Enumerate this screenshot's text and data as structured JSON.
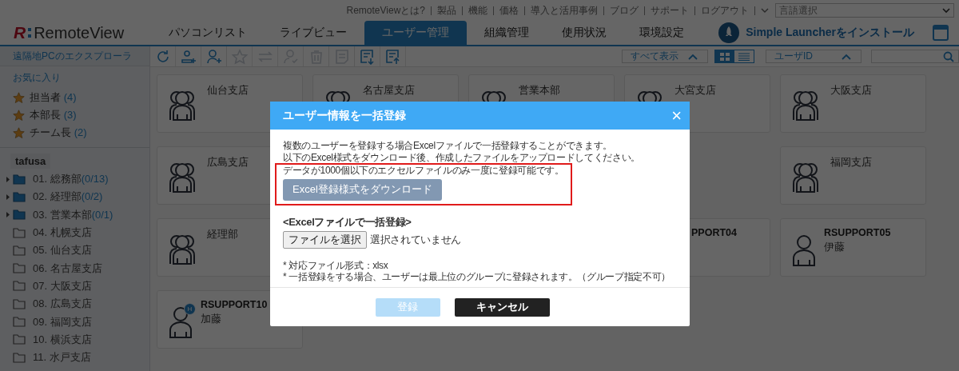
{
  "top_links": [
    "RemoteViewとは?",
    "製品",
    "機能",
    "価格",
    "導入と活用事例",
    "ブログ",
    "サポート",
    "ログアウト"
  ],
  "language_select": {
    "value": "言語選択"
  },
  "logo": {
    "mark": "R",
    "text": "RemoteView"
  },
  "nav_tabs": [
    {
      "label": "パソコンリスト",
      "selected": false
    },
    {
      "label": "ライブビュー",
      "selected": false
    },
    {
      "label": "ユーザー管理",
      "selected": true
    },
    {
      "label": "組織管理",
      "selected": false
    },
    {
      "label": "使用状況",
      "selected": false
    },
    {
      "label": "環境設定",
      "selected": false
    }
  ],
  "launcher": {
    "label": "Simple Launcherをインストール"
  },
  "sidebar": {
    "explorer_link": "遠隔地PCのエクスプローラ",
    "favorites_title": "お気に入り",
    "favorites": [
      {
        "name": "担当者",
        "count": "(4)"
      },
      {
        "name": "本部長",
        "count": "(3)"
      },
      {
        "name": "チーム長",
        "count": "(2)"
      }
    ],
    "tree_root": "tafusa",
    "groups": [
      {
        "label": "01. 総務部",
        "count": "(0/13)",
        "has_children": true
      },
      {
        "label": "02. 経理部",
        "count": "(0/2)",
        "has_children": true
      },
      {
        "label": "03. 営業本部",
        "count": "(0/1)",
        "has_children": true
      },
      {
        "label": "04. 札幌支店",
        "has_children": false
      },
      {
        "label": "05. 仙台支店",
        "has_children": false
      },
      {
        "label": "06. 名古屋支店",
        "has_children": false
      },
      {
        "label": "07. 大阪支店",
        "has_children": false
      },
      {
        "label": "08. 広島支店",
        "has_children": false
      },
      {
        "label": "09. 福岡支店",
        "has_children": false
      },
      {
        "label": "10. 横浜支店",
        "has_children": false
      },
      {
        "label": "11. 水戸支店",
        "has_children": false
      }
    ]
  },
  "toolbar": {
    "tools": [
      {
        "kind": "refresh",
        "disabled": false
      },
      {
        "kind": "add-group",
        "disabled": false
      },
      {
        "kind": "add-user",
        "disabled": false
      },
      {
        "kind": "star",
        "disabled": true
      },
      {
        "kind": "transfer",
        "disabled": true
      },
      {
        "kind": "user-check",
        "disabled": true
      },
      {
        "kind": "trash",
        "disabled": true
      },
      {
        "kind": "note",
        "disabled": true
      },
      {
        "kind": "download",
        "disabled": false
      },
      {
        "kind": "upload",
        "disabled": false
      }
    ],
    "filter": "すべて表示",
    "view_modes": [
      {
        "kind": "grid",
        "selected": true
      },
      {
        "kind": "list",
        "selected": false
      }
    ],
    "sort": "ユーザID"
  },
  "cards": [
    [
      {
        "kind": "group",
        "name": "仙台支店"
      },
      {
        "kind": "group-top",
        "name": "名古屋支店"
      },
      {
        "kind": "group-top",
        "name": "営業本部"
      },
      {
        "kind": "group-top",
        "name": "大宮支店"
      },
      {
        "kind": "group",
        "name": "大阪支店"
      }
    ],
    [
      {
        "kind": "group",
        "name": "広島支店"
      },
      {
        "kind": "covered"
      },
      {
        "kind": "covered"
      },
      {
        "kind": "covered"
      },
      {
        "kind": "group",
        "name": "福岡支店"
      }
    ],
    [
      {
        "kind": "group",
        "name": "経理部"
      },
      {
        "kind": "covered"
      },
      {
        "kind": "covered"
      },
      {
        "kind": "cut",
        "name": "PPORT04"
      },
      {
        "kind": "user",
        "name": "RSUPPORT05",
        "sub": "伊藤"
      }
    ],
    [
      {
        "kind": "user",
        "name": "RSUPPORT10",
        "sub": "加藤",
        "badge": "H"
      }
    ]
  ],
  "dialog": {
    "title": "ユーザー情報を一括登録",
    "close": "×",
    "lines": [
      "複数のユーザーを登録する場合Excelファイルで一括登録することができます。",
      "以下のExcel様式をダウンロード後、作成したファイルをアップロードしてください。"
    ],
    "highlight_line": "データが1000個以下のエクセルファイルのみ一度に登録可能です。",
    "download_button": "Excel登録様式をダウンロード",
    "section_title": "<Excelファイルで一括登録>",
    "file_button": "ファイルを選択",
    "file_status": "選択されていません",
    "notes": [
      "* 対応ファイル形式：xlsx",
      "* 一括登録をする場合、ユーザーは最上位のグループに登録されます。（グループ指定不可）"
    ],
    "submit": {
      "label": "登録",
      "disabled": true
    },
    "cancel": {
      "label": "キャンセル"
    }
  }
}
